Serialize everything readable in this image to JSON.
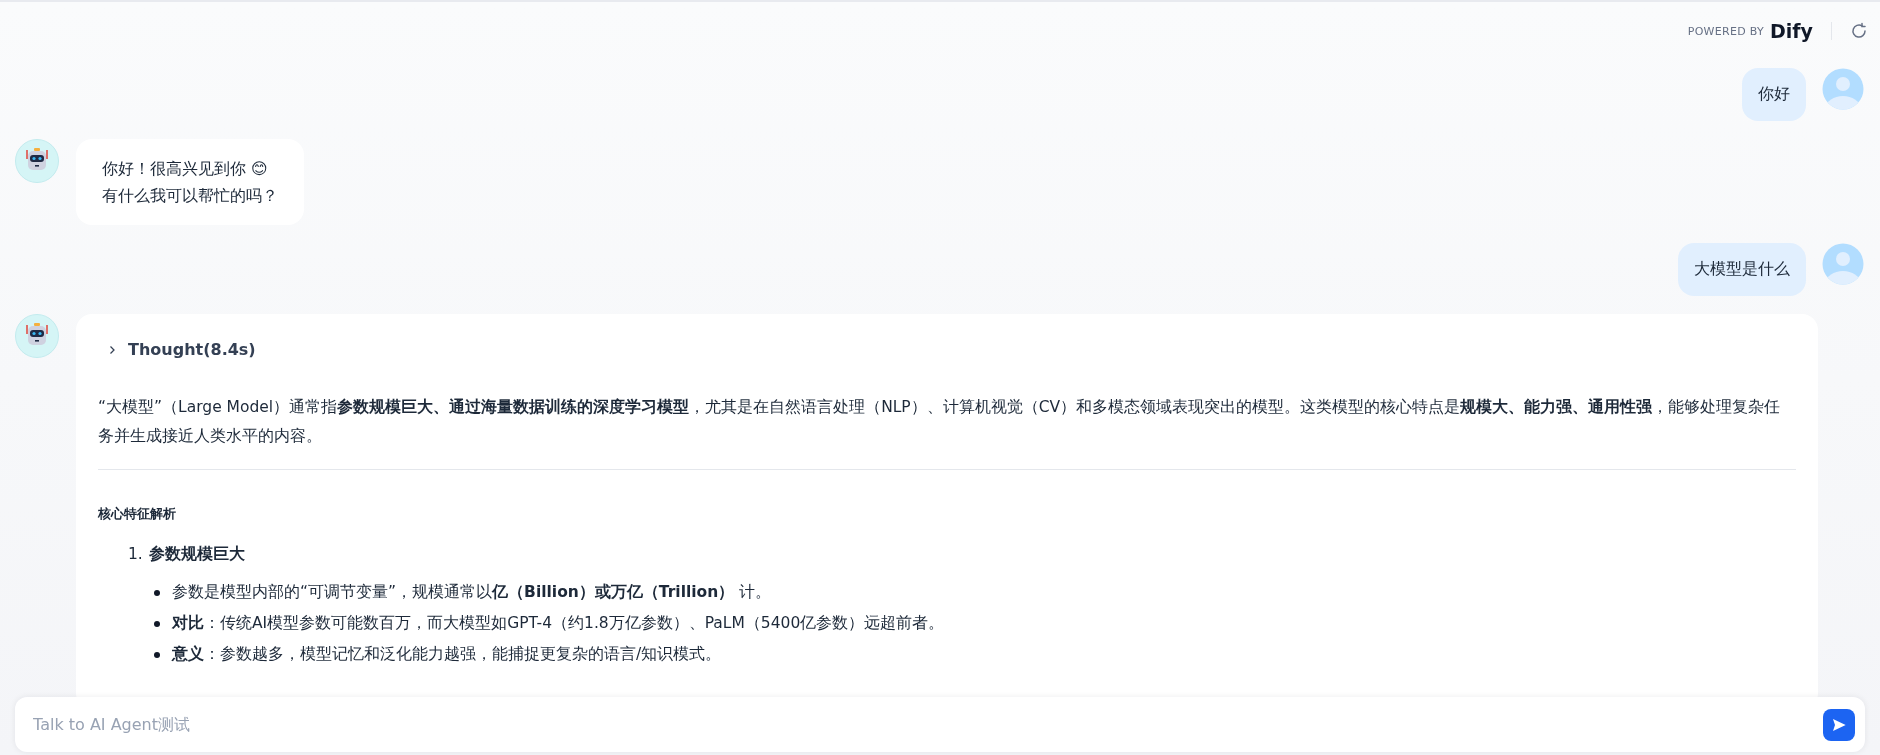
{
  "header": {
    "powered_by": "POWERED BY",
    "brand": "Dify"
  },
  "messages": [
    {
      "kind": "user",
      "text": "你好"
    },
    {
      "kind": "bot",
      "lines": [
        "你好！很高兴见到你 😊",
        "有什么我可以帮忙的吗？"
      ]
    },
    {
      "kind": "user",
      "text": "大模型是什么"
    },
    {
      "kind": "bot",
      "thought": {
        "label": "Thought(8.4s)",
        "expanded": false
      },
      "paragraph": "“大模型”（Large Model）通常指**参数规模巨大、通过海量数据训练的深度学习模型**，尤其是在自然语言处理（NLP）、计算机视觉（CV）和多模态领域表现突出的模型。这类模型的核心特点是**规模大、能力强、通用性强**，能够处理复杂任务并生成接近人类水平的内容。",
      "heading": "核心特征解析",
      "list": [
        {
          "number": "1.",
          "title": "参数规模巨大",
          "bullets": [
            "参数是模型内部的“可调节变量”，规模通常以**亿（Billion）或万亿（Trillion）** 计。",
            "**对比**：传统AI模型参数可能数百万，而大模型如GPT-4（约1.8万亿参数）、PaLM（5400亿参数）远超前者。",
            "**意义**：参数越多，模型记忆和泛化能力越强，能捕捉更复杂的语言/知识模式。"
          ]
        }
      ]
    }
  ],
  "input": {
    "placeholder": "Talk to AI Agent测试"
  }
}
